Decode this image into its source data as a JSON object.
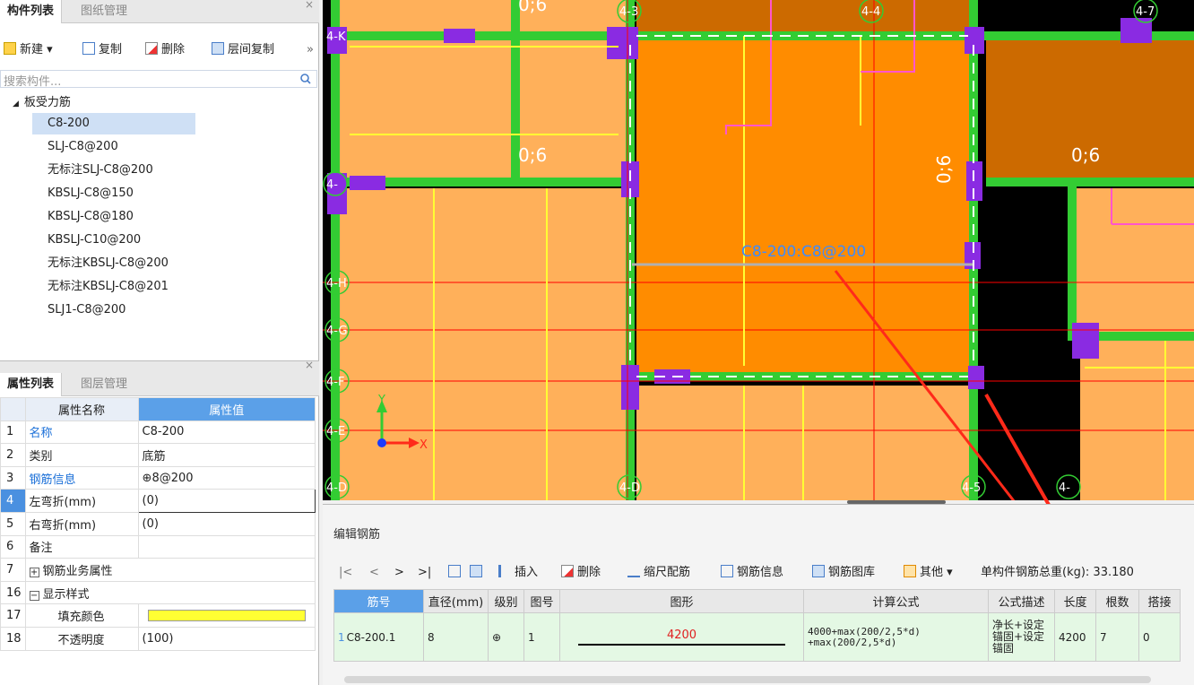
{
  "component_panel": {
    "tabs": [
      "构件列表",
      "图纸管理"
    ],
    "toolbar": {
      "new": "新建",
      "copy": "复制",
      "delete": "删除",
      "floor_copy": "层间复制",
      "more": "»"
    },
    "search_placeholder": "搜索构件...",
    "tree_root": "板受力筋",
    "items": [
      "C8-200",
      "SLJ-C8@200",
      "无标注SLJ-C8@200",
      "KBSLJ-C8@150",
      "KBSLJ-C8@180",
      "KBSLJ-C10@200",
      "无标注KBSLJ-C8@200",
      "无标注KBSLJ-C8@201",
      "SLJ1-C8@200"
    ],
    "selected_index": 0
  },
  "property_panel": {
    "tabs": [
      "属性列表",
      "图层管理"
    ],
    "header": {
      "name": "属性名称",
      "value": "属性值"
    },
    "rows": [
      {
        "num": "1",
        "name": "名称",
        "value": "C8-200",
        "blue": true
      },
      {
        "num": "2",
        "name": "类别",
        "value": "底筋",
        "blue": false
      },
      {
        "num": "3",
        "name": "钢筋信息",
        "value": "⊕8@200",
        "blue": true
      },
      {
        "num": "4",
        "name": "左弯折(mm)",
        "value": "(0)",
        "blue": false
      },
      {
        "num": "5",
        "name": "右弯折(mm)",
        "value": "(0)",
        "blue": false
      },
      {
        "num": "6",
        "name": "备注",
        "value": "",
        "blue": false
      },
      {
        "num": "7",
        "name": "钢筋业务属性",
        "value": "",
        "blue": false
      },
      {
        "num": "16",
        "name": "显示样式",
        "value": "",
        "blue": false
      },
      {
        "num": "17",
        "name": "填充颜色",
        "value": "",
        "blue": false
      },
      {
        "num": "18",
        "name": "不透明度",
        "value": "(100)",
        "blue": false
      }
    ],
    "fill_color": "#ffff33"
  },
  "canvas": {
    "rebar_label": "C8-200:C8@200",
    "axis_labels": [
      "4-3",
      "4-4",
      "4-7",
      "4-K",
      "4-",
      "4-H",
      "4-G",
      "4-F",
      "4-E",
      "4-D",
      "4-5",
      "4-"
    ],
    "dim_labels": [
      "0;6",
      "0;6",
      "0;6",
      "0;6"
    ],
    "axis_x": "X",
    "axis_y": "Y"
  },
  "edit_panel": {
    "title": "编辑钢筋",
    "nav": [
      "|<",
      "<",
      ">",
      ">|"
    ],
    "toolbar": {
      "insert": "插入",
      "delete": "删除",
      "scale": "缩尺配筋",
      "info": "钢筋信息",
      "library": "钢筋图库",
      "other": "其他"
    },
    "total_weight": "单构件钢筋总重(kg): 33.180",
    "columns": [
      "筋号",
      "直径(mm)",
      "级别",
      "图号",
      "图形",
      "计算公式",
      "公式描述",
      "长度",
      "根数",
      "搭接"
    ],
    "row": {
      "index": "1",
      "bar_no": "C8-200.1",
      "diameter": "8",
      "grade": "⊕",
      "shape_no": "1",
      "shape_length": "4200",
      "formula_line1": "4000+max(200/2,5*d)",
      "formula_line2": "+max(200/2,5*d)",
      "desc_line1": "净长+设定",
      "desc_line2": "锚固+设定",
      "desc_line3": "锚固",
      "length": "4200",
      "count": "7",
      "lap": "0"
    }
  },
  "colors": {
    "accent": "#5ba0e8",
    "selected": "#cfe0f5",
    "slab": "#ffb05a",
    "slab_dark": "#ff8c00",
    "beam": "#33cc33",
    "column": "#8a2be2",
    "arrow": "#ff2a1a"
  }
}
